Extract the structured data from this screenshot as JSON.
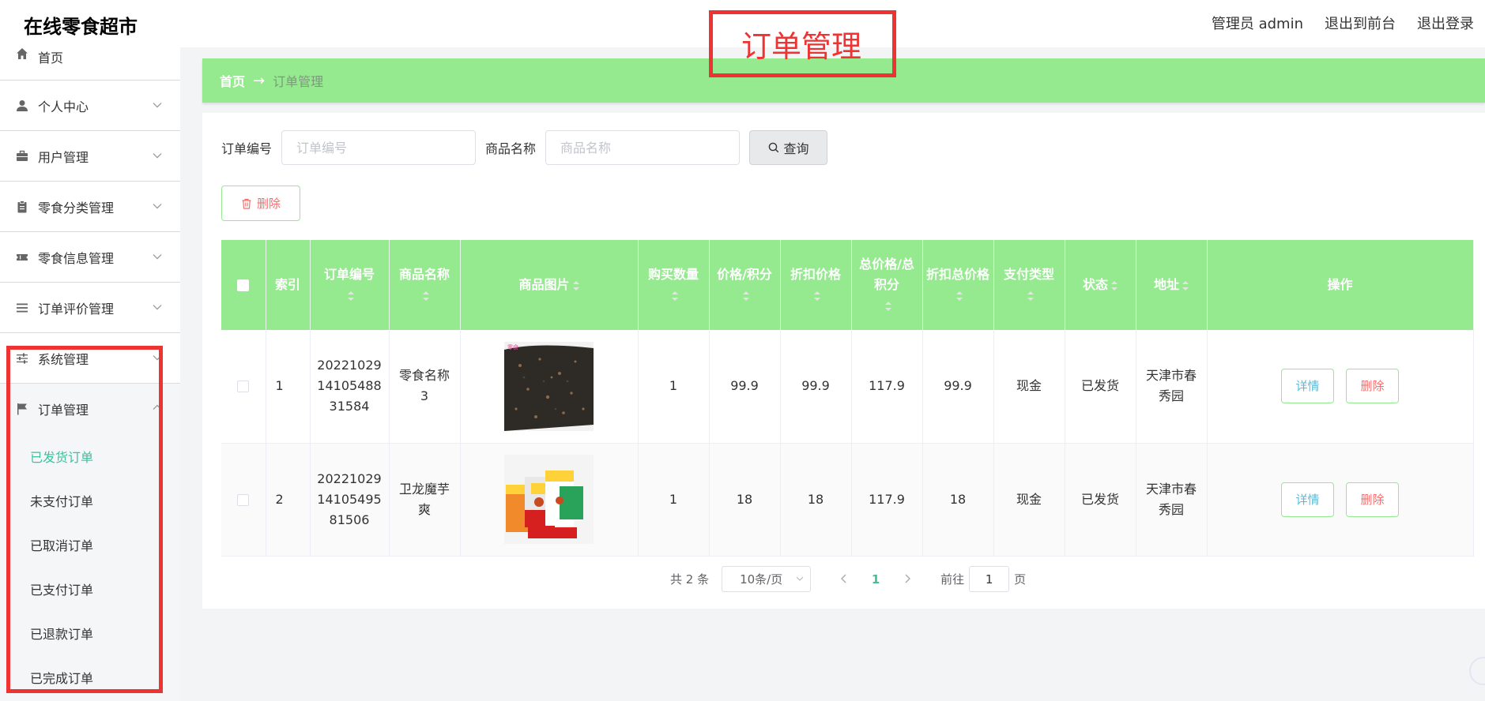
{
  "header": {
    "title": "在线零食超市",
    "admin_label": "管理员 admin",
    "to_front_label": "退出到前台",
    "logout_label": "退出登录",
    "annotation": "订单管理"
  },
  "sidebar": {
    "items": [
      {
        "label": "首页",
        "icon": "home-icon"
      },
      {
        "label": "个人中心",
        "icon": "user-icon"
      },
      {
        "label": "用户管理",
        "icon": "briefcase-icon"
      },
      {
        "label": "零食分类管理",
        "icon": "clipboard-icon"
      },
      {
        "label": "零食信息管理",
        "icon": "ticket-icon"
      },
      {
        "label": "订单评价管理",
        "icon": "list-icon"
      },
      {
        "label": "系统管理",
        "icon": "sliders-icon"
      }
    ],
    "group": {
      "label": "订单管理",
      "icon": "flag-icon",
      "sub_items": [
        "已发货订单",
        "未支付订单",
        "已取消订单",
        "已支付订单",
        "已退款订单",
        "已完成订单"
      ]
    }
  },
  "breadcrumb": {
    "home": "首页",
    "arrow": "→",
    "current": "订单管理"
  },
  "search": {
    "order_no_label": "订单编号",
    "order_no_placeholder": "订单编号",
    "product_label": "商品名称",
    "product_placeholder": "商品名称",
    "query_label": "查询"
  },
  "toolbar": {
    "delete_label": "删除"
  },
  "table": {
    "headers": {
      "index": "索引",
      "order_no": "订单编号",
      "product_name": "商品名称",
      "product_image": "商品图片",
      "quantity": "购买数量",
      "price": "价格/积分",
      "discount_price": "折扣价格",
      "total_price": "总价格/总积分",
      "discount_total": "折扣总价格",
      "payment_type": "支付类型",
      "status": "状态",
      "address": "地址",
      "actions": "操作"
    },
    "rows": [
      {
        "index": "1",
        "order_no": "2022102914105488 31584",
        "order_no_lines": [
          "20221029",
          "14105488",
          "31584"
        ],
        "product_name": "零食名称3",
        "product_name_lines": [
          "零食名称",
          "3"
        ],
        "quantity": "1",
        "price": "99.9",
        "discount_price": "99.9",
        "total_price": "117.9",
        "discount_total": "99.9",
        "payment_type": "现金",
        "status": "已发货",
        "address_lines": [
          "天津市春",
          "秀园"
        ],
        "detail_label": "详情",
        "delete_label": "删除"
      },
      {
        "index": "2",
        "order_no_lines": [
          "20221029",
          "14105495",
          "81506"
        ],
        "product_name_lines": [
          "卫龙魔芋",
          "爽"
        ],
        "quantity": "1",
        "price": "18",
        "discount_price": "18",
        "total_price": "117.9",
        "discount_total": "18",
        "payment_type": "现金",
        "status": "已发货",
        "address_lines": [
          "天津市春",
          "秀园"
        ],
        "detail_label": "详情",
        "delete_label": "删除"
      }
    ]
  },
  "pagination": {
    "total_text": "共 2 条",
    "page_size": "10条/页",
    "current_page": "1",
    "goto_prefix": "前往",
    "goto_value": "1",
    "goto_suffix": "页"
  },
  "colors": {
    "accent_green": "#95ea8f",
    "active_text": "#3fbf9a",
    "danger": "#f56c6c",
    "annotation_red": "#ee3333"
  }
}
